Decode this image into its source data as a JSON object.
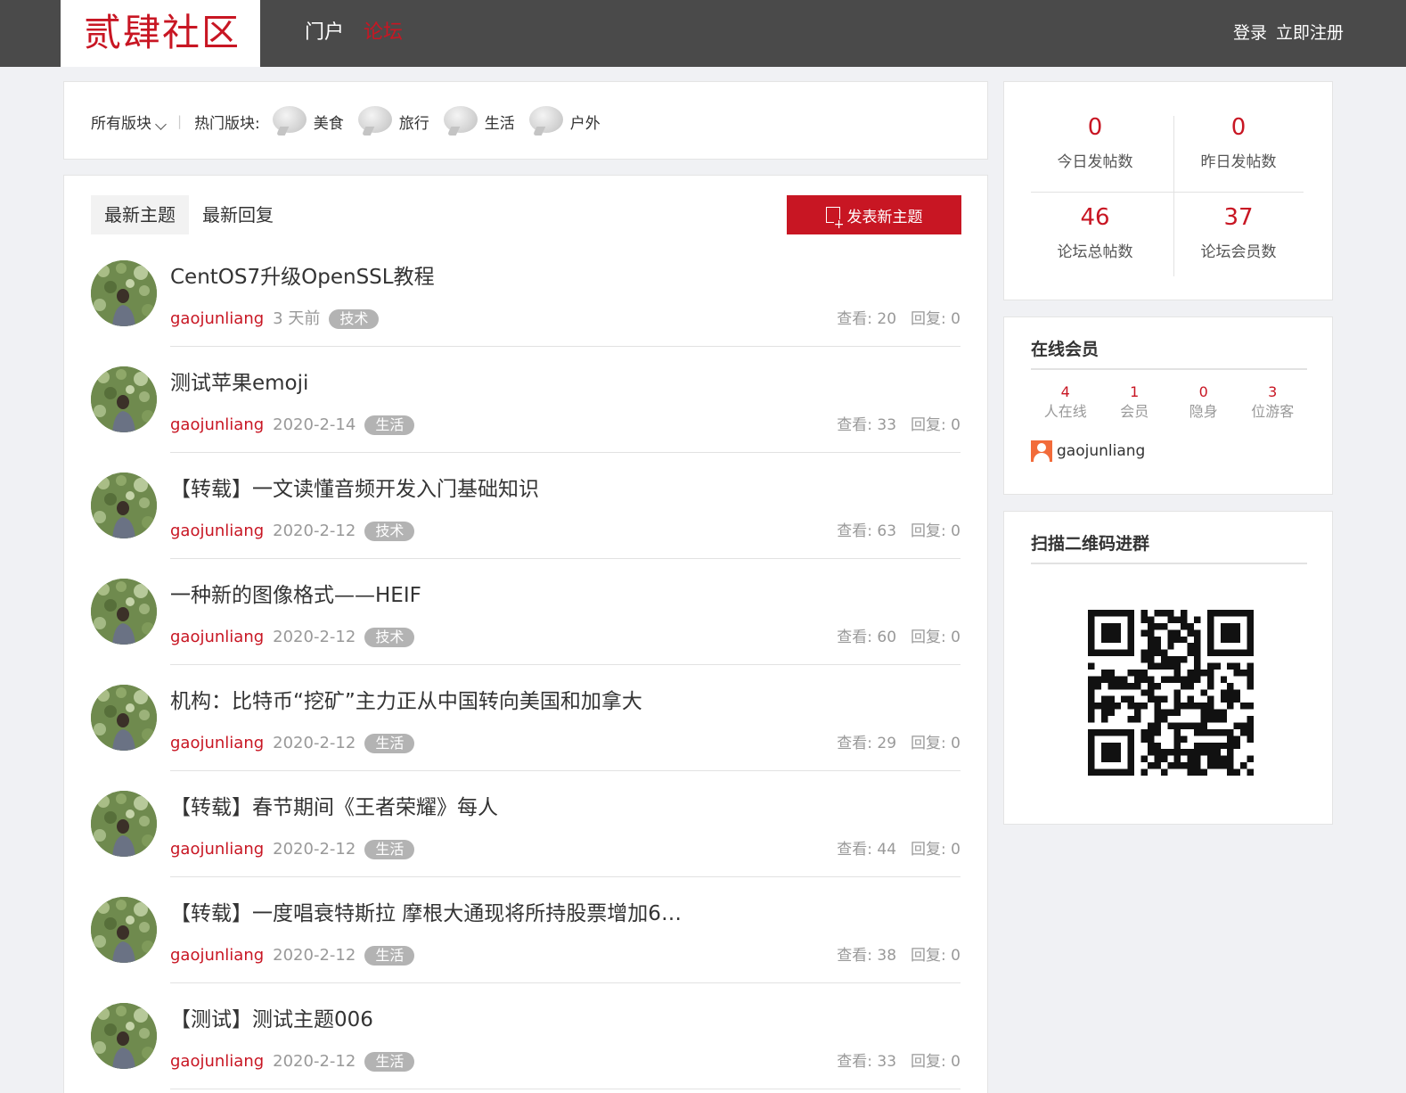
{
  "header": {
    "logo": "贰肆社区",
    "nav": [
      {
        "label": "门户",
        "active": false
      },
      {
        "label": "论坛",
        "active": true
      }
    ],
    "login": "登录",
    "register": "立即注册"
  },
  "boards": {
    "all_label": "所有版块",
    "hot_label": "热门版块:",
    "items": [
      "美食",
      "旅行",
      "生活",
      "户外"
    ]
  },
  "threads": {
    "tabs": [
      "最新主题",
      "最新回复"
    ],
    "post_button": "发表新主题",
    "views_prefix": "查看:",
    "replies_prefix": "回复:",
    "list": [
      {
        "title": "CentOS7升级OpenSSL教程",
        "author": "gaojunliang",
        "time": "3 天前",
        "tag": "技术",
        "views": 20,
        "replies": 0
      },
      {
        "title": "测试苹果emoji",
        "author": "gaojunliang",
        "time": "2020-2-14",
        "tag": "生活",
        "views": 33,
        "replies": 0
      },
      {
        "title": "【转载】一文读懂音频开发入门基础知识",
        "author": "gaojunliang",
        "time": "2020-2-12",
        "tag": "技术",
        "views": 63,
        "replies": 0
      },
      {
        "title": "一种新的图像格式——HEIF",
        "author": "gaojunliang",
        "time": "2020-2-12",
        "tag": "技术",
        "views": 60,
        "replies": 0
      },
      {
        "title": "机构：比特币“挖矿”主力正从中国转向美国和加拿大",
        "author": "gaojunliang",
        "time": "2020-2-12",
        "tag": "生活",
        "views": 29,
        "replies": 0
      },
      {
        "title": "【转载】春节期间《王者荣耀》每人",
        "author": "gaojunliang",
        "time": "2020-2-12",
        "tag": "生活",
        "views": 44,
        "replies": 0
      },
      {
        "title": "【转载】一度唱衰特斯拉 摩根大通现将所持股票增加6…",
        "author": "gaojunliang",
        "time": "2020-2-12",
        "tag": "生活",
        "views": 38,
        "replies": 0
      },
      {
        "title": "【测试】测试主题006",
        "author": "gaojunliang",
        "time": "2020-2-12",
        "tag": "生活",
        "views": 33,
        "replies": 0
      }
    ]
  },
  "stats": {
    "today_posts": {
      "value": "0",
      "label": "今日发帖数"
    },
    "yesterday_posts": {
      "value": "0",
      "label": "昨日发帖数"
    },
    "total_posts": {
      "value": "46",
      "label": "论坛总帖数"
    },
    "members": {
      "value": "37",
      "label": "论坛会员数"
    }
  },
  "online": {
    "title": "在线会员",
    "cells": [
      {
        "num": "4",
        "label": "人在线"
      },
      {
        "num": "1",
        "label": "会员"
      },
      {
        "num": "0",
        "label": "隐身"
      },
      {
        "num": "3",
        "label": "位游客"
      }
    ],
    "member_name": "gaojunliang"
  },
  "qr": {
    "title": "扫描二维码进群"
  },
  "colors": {
    "accent": "#c81623",
    "header_bg": "#4a4a4a",
    "page_bg": "#f0f1f4",
    "tag_bg": "#b3b3b3"
  }
}
